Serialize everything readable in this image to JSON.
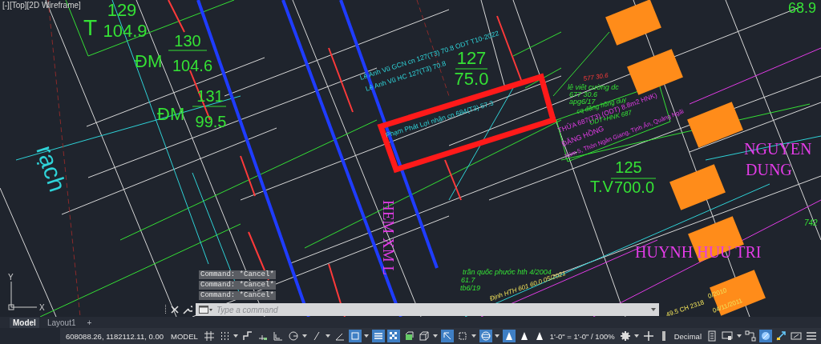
{
  "viewport": {
    "label": "[-][Top][2D Wireframe]"
  },
  "drawing": {
    "texts": [
      {
        "text": "T",
        "kind": "parcel-code"
      },
      {
        "text": "129",
        "kind": "parcel-number"
      },
      {
        "text": "104.9",
        "kind": "area"
      },
      {
        "text": "ĐM",
        "kind": "parcel-code"
      },
      {
        "text": "130",
        "kind": "parcel-number"
      },
      {
        "text": "104.6",
        "kind": "area"
      },
      {
        "text": "ĐM",
        "kind": "parcel-code"
      },
      {
        "text": "131",
        "kind": "parcel-number"
      },
      {
        "text": "99.5",
        "kind": "area"
      },
      {
        "text": "rạch",
        "kind": "river-name"
      },
      {
        "text": "Lê Anh Vũ GCN cn 127(T3) 70.8 ODT T10-2022",
        "kind": "owner-note"
      },
      {
        "text": "Lê Anh Vũ HC 127(T3) 70.8",
        "kind": "owner-note"
      },
      {
        "text": "127",
        "kind": "parcel-number"
      },
      {
        "text": "75.0",
        "kind": "area"
      },
      {
        "text": "Phạm Phát Lợi nhận cn 684(T3) 57.3",
        "kind": "owner-note"
      },
      {
        "text": "577 30.6",
        "kind": "owner-note"
      },
      {
        "text": "lê viết cường dc",
        "kind": "owner-note"
      },
      {
        "text": "677 30.6",
        "kind": "owner-note"
      },
      {
        "text": "apg6/17",
        "kind": "owner-note"
      },
      {
        "text": "cq đặng hồng duy",
        "kind": "owner-note"
      },
      {
        "text": "ODT+HNK 687",
        "kind": "owner-note"
      },
      {
        "text": "THỬA 687(T3) (ODT) 8.8m2 HNK)",
        "kind": "owner-note"
      },
      {
        "text": "ĐẶNG HỒNG",
        "kind": "owner-note"
      },
      {
        "text": "Xóm 5, Thôn Ngân Giang, Tịnh Ấn, Quảng Ngãi",
        "kind": "owner-note"
      },
      {
        "text": "NGUYEN",
        "kind": "owner-name"
      },
      {
        "text": "DUNG",
        "kind": "owner-name"
      },
      {
        "text": "T.V",
        "kind": "parcel-code"
      },
      {
        "text": "125",
        "kind": "parcel-number"
      },
      {
        "text": "700.0",
        "kind": "area"
      },
      {
        "text": "68.9",
        "kind": "area"
      },
      {
        "text": "742",
        "kind": "owner-note"
      },
      {
        "text": "HUYNH HUU TRI",
        "kind": "owner-name"
      },
      {
        "text": "HEM XM L",
        "kind": "road-name"
      },
      {
        "text": "trần quốc phước hth 4/2004",
        "kind": "owner-note"
      },
      {
        "text": "61.7",
        "kind": "owner-note"
      },
      {
        "text": "tb6/19",
        "kind": "owner-note"
      },
      {
        "text": "Định HTH 601 60.0 05/2021",
        "kind": "owner-note"
      },
      {
        "text": "0/2010",
        "kind": "owner-note"
      },
      {
        "text": "04/11/2011",
        "kind": "owner-note"
      },
      {
        "text": "49.5 CH 2318",
        "kind": "owner-note"
      }
    ]
  },
  "ucs": {
    "y_label": "Y",
    "x_label": "X"
  },
  "command_history": [
    "Command: *Cancel*",
    "Command: *Cancel*",
    "Command: *Cancel*"
  ],
  "command_line": {
    "placeholder": "Type a command"
  },
  "tabs": [
    {
      "label": "Model",
      "selected": true
    },
    {
      "label": "Layout1",
      "selected": false
    },
    {
      "label": "+",
      "selected": false
    }
  ],
  "status_bar": {
    "items": [
      {
        "kind": "text",
        "text": "608088.26, 1182112.11, 0.00"
      },
      {
        "kind": "text",
        "text": "MODEL"
      },
      {
        "kind": "toggle",
        "on": false
      },
      {
        "kind": "toggle",
        "on": false
      },
      {
        "kind": "caret"
      },
      {
        "kind": "toggle",
        "on": false
      },
      {
        "kind": "toggle",
        "on": false
      },
      {
        "kind": "toggle",
        "on": false
      },
      {
        "kind": "toggle",
        "on": false
      },
      {
        "kind": "caret"
      },
      {
        "kind": "toggle",
        "on": false
      },
      {
        "kind": "caret"
      },
      {
        "kind": "toggle",
        "on": false
      },
      {
        "kind": "toggle",
        "on": true
      },
      {
        "kind": "caret"
      },
      {
        "kind": "toggle",
        "on": true
      },
      {
        "kind": "toggle",
        "on": true
      },
      {
        "kind": "toggle",
        "on": false
      },
      {
        "kind": "toggle",
        "on": false
      },
      {
        "kind": "caret"
      },
      {
        "kind": "toggle",
        "on": true
      },
      {
        "kind": "toggle",
        "on": false
      },
      {
        "kind": "caret"
      },
      {
        "kind": "toggle",
        "on": true
      },
      {
        "kind": "caret"
      },
      {
        "kind": "toggle",
        "on": true
      },
      {
        "kind": "toggle",
        "on": false
      },
      {
        "kind": "toggle",
        "on": false
      },
      {
        "kind": "dropdown",
        "text": "1'-0\" = 1'-0\" / 100%"
      },
      {
        "kind": "toggle",
        "on": false
      },
      {
        "kind": "caret"
      },
      {
        "kind": "toggle",
        "on": false
      },
      {
        "kind": "toggle",
        "on": false
      },
      {
        "kind": "dropdown",
        "text": "Decimal"
      },
      {
        "kind": "toggle",
        "on": false
      },
      {
        "kind": "toggle",
        "on": false
      },
      {
        "kind": "caret"
      },
      {
        "kind": "toggle",
        "on": false
      },
      {
        "kind": "toggle",
        "on": true
      },
      {
        "kind": "toggle",
        "on": false
      },
      {
        "kind": "toggle",
        "on": false
      },
      {
        "kind": "toggle",
        "on": false
      }
    ]
  }
}
